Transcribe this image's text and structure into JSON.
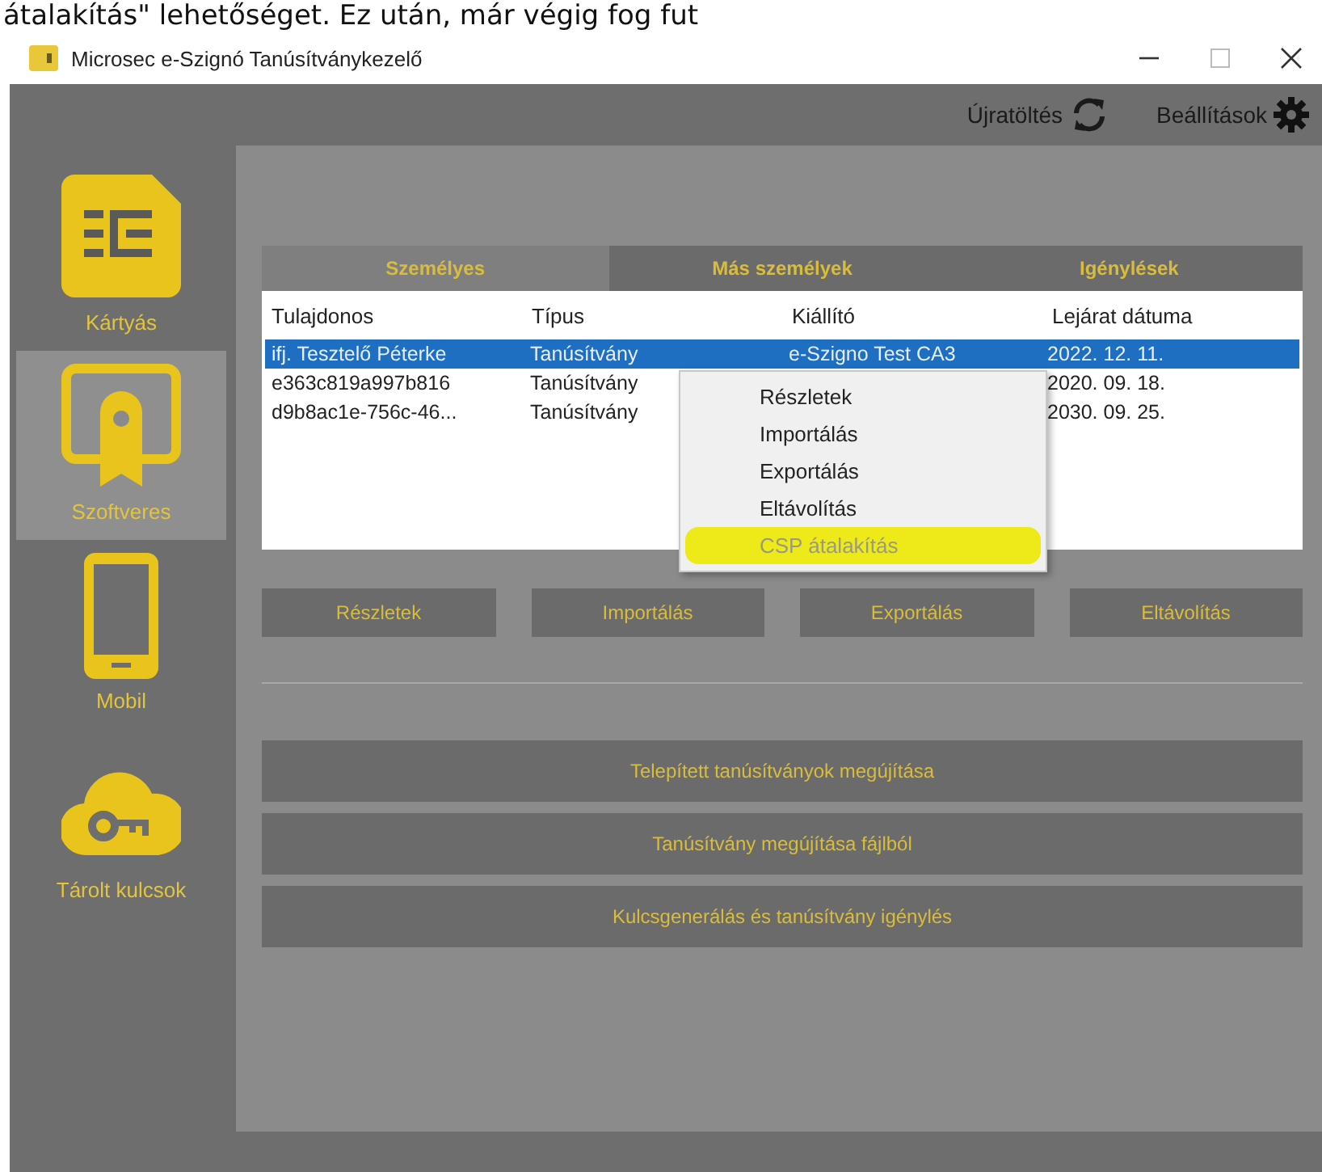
{
  "page_caption": "átalakítás\" lehetőséget. Ez után, már végig fog fut",
  "window": {
    "title": "Microsec e-Szignó Tanúsítványkezelő"
  },
  "toolbar": [
    {
      "label": "Újratöltés",
      "kind": "reload"
    },
    {
      "label": "Beállítások",
      "kind": "settings"
    }
  ],
  "sidebar": {
    "items": [
      {
        "label": "Kártyás",
        "kind": "card",
        "selected": false
      },
      {
        "label": "Szoftveres",
        "kind": "software",
        "selected": true
      },
      {
        "label": "Mobil",
        "kind": "mobile",
        "selected": false
      },
      {
        "label": "Tárolt kulcsok",
        "kind": "cloud",
        "selected": false
      }
    ]
  },
  "tabs": [
    {
      "label": "Személyes",
      "selected": true
    },
    {
      "label": "Más személyek",
      "selected": false
    },
    {
      "label": "Igénylések",
      "selected": false
    }
  ],
  "table": {
    "columns": [
      "Tulajdonos",
      "Típus",
      "Kiállító",
      "Lejárat dátuma"
    ],
    "rows": [
      {
        "selected": true,
        "owner": "ifj. Tesztelő Péterke",
        "type": "Tanúsítvány",
        "issuer": "e-Szigno Test CA3",
        "expiry": "2022. 12. 11."
      },
      {
        "selected": false,
        "owner": "e363c819a997b816",
        "type": "Tanúsítvány",
        "expiry": "2020. 09. 18."
      },
      {
        "selected": false,
        "owner": "d9b8ac1e-756c-46...",
        "type": "Tanúsítvány",
        "expiry": "2030. 09. 25."
      }
    ]
  },
  "context_menu": {
    "items": [
      {
        "label": "Részletek",
        "disabled": false,
        "highlighted": false
      },
      {
        "label": "Importálás",
        "disabled": false,
        "highlighted": false
      },
      {
        "label": "Exportálás",
        "disabled": false,
        "highlighted": false
      },
      {
        "label": "Eltávolítás",
        "disabled": false,
        "highlighted": false
      },
      {
        "label": "CSP átalakítás",
        "disabled": true,
        "highlighted": true
      }
    ]
  },
  "action_buttons": [
    "Részletek",
    "Importálás",
    "Exportálás",
    "Eltávolítás"
  ],
  "wide_buttons": [
    "Telepített tanúsítványok megújítása",
    "Tanúsítvány megújítása fájlból",
    "Kulcsgenerálás és tanúsítvány igénylés"
  ]
}
